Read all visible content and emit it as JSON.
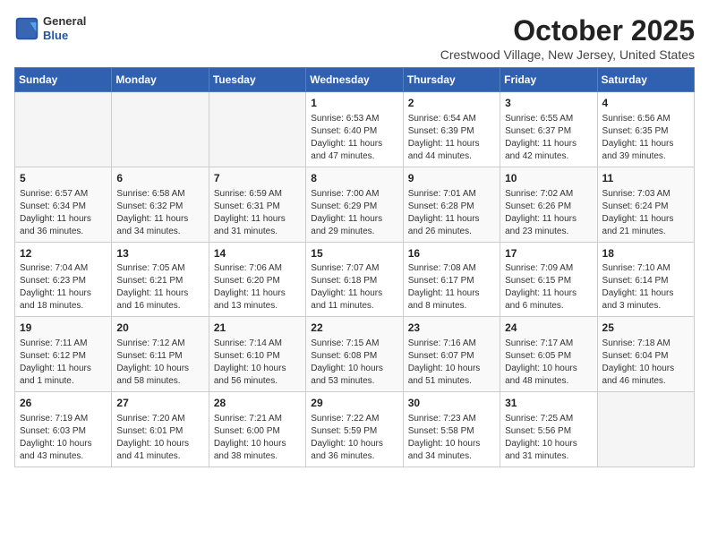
{
  "header": {
    "logo_line1": "General",
    "logo_line2": "Blue",
    "month": "October 2025",
    "location": "Crestwood Village, New Jersey, United States"
  },
  "weekdays": [
    "Sunday",
    "Monday",
    "Tuesday",
    "Wednesday",
    "Thursday",
    "Friday",
    "Saturday"
  ],
  "weeks": [
    [
      {
        "day": "",
        "info": ""
      },
      {
        "day": "",
        "info": ""
      },
      {
        "day": "",
        "info": ""
      },
      {
        "day": "1",
        "info": "Sunrise: 6:53 AM\nSunset: 6:40 PM\nDaylight: 11 hours and 47 minutes."
      },
      {
        "day": "2",
        "info": "Sunrise: 6:54 AM\nSunset: 6:39 PM\nDaylight: 11 hours and 44 minutes."
      },
      {
        "day": "3",
        "info": "Sunrise: 6:55 AM\nSunset: 6:37 PM\nDaylight: 11 hours and 42 minutes."
      },
      {
        "day": "4",
        "info": "Sunrise: 6:56 AM\nSunset: 6:35 PM\nDaylight: 11 hours and 39 minutes."
      }
    ],
    [
      {
        "day": "5",
        "info": "Sunrise: 6:57 AM\nSunset: 6:34 PM\nDaylight: 11 hours and 36 minutes."
      },
      {
        "day": "6",
        "info": "Sunrise: 6:58 AM\nSunset: 6:32 PM\nDaylight: 11 hours and 34 minutes."
      },
      {
        "day": "7",
        "info": "Sunrise: 6:59 AM\nSunset: 6:31 PM\nDaylight: 11 hours and 31 minutes."
      },
      {
        "day": "8",
        "info": "Sunrise: 7:00 AM\nSunset: 6:29 PM\nDaylight: 11 hours and 29 minutes."
      },
      {
        "day": "9",
        "info": "Sunrise: 7:01 AM\nSunset: 6:28 PM\nDaylight: 11 hours and 26 minutes."
      },
      {
        "day": "10",
        "info": "Sunrise: 7:02 AM\nSunset: 6:26 PM\nDaylight: 11 hours and 23 minutes."
      },
      {
        "day": "11",
        "info": "Sunrise: 7:03 AM\nSunset: 6:24 PM\nDaylight: 11 hours and 21 minutes."
      }
    ],
    [
      {
        "day": "12",
        "info": "Sunrise: 7:04 AM\nSunset: 6:23 PM\nDaylight: 11 hours and 18 minutes."
      },
      {
        "day": "13",
        "info": "Sunrise: 7:05 AM\nSunset: 6:21 PM\nDaylight: 11 hours and 16 minutes."
      },
      {
        "day": "14",
        "info": "Sunrise: 7:06 AM\nSunset: 6:20 PM\nDaylight: 11 hours and 13 minutes."
      },
      {
        "day": "15",
        "info": "Sunrise: 7:07 AM\nSunset: 6:18 PM\nDaylight: 11 hours and 11 minutes."
      },
      {
        "day": "16",
        "info": "Sunrise: 7:08 AM\nSunset: 6:17 PM\nDaylight: 11 hours and 8 minutes."
      },
      {
        "day": "17",
        "info": "Sunrise: 7:09 AM\nSunset: 6:15 PM\nDaylight: 11 hours and 6 minutes."
      },
      {
        "day": "18",
        "info": "Sunrise: 7:10 AM\nSunset: 6:14 PM\nDaylight: 11 hours and 3 minutes."
      }
    ],
    [
      {
        "day": "19",
        "info": "Sunrise: 7:11 AM\nSunset: 6:12 PM\nDaylight: 11 hours and 1 minute."
      },
      {
        "day": "20",
        "info": "Sunrise: 7:12 AM\nSunset: 6:11 PM\nDaylight: 10 hours and 58 minutes."
      },
      {
        "day": "21",
        "info": "Sunrise: 7:14 AM\nSunset: 6:10 PM\nDaylight: 10 hours and 56 minutes."
      },
      {
        "day": "22",
        "info": "Sunrise: 7:15 AM\nSunset: 6:08 PM\nDaylight: 10 hours and 53 minutes."
      },
      {
        "day": "23",
        "info": "Sunrise: 7:16 AM\nSunset: 6:07 PM\nDaylight: 10 hours and 51 minutes."
      },
      {
        "day": "24",
        "info": "Sunrise: 7:17 AM\nSunset: 6:05 PM\nDaylight: 10 hours and 48 minutes."
      },
      {
        "day": "25",
        "info": "Sunrise: 7:18 AM\nSunset: 6:04 PM\nDaylight: 10 hours and 46 minutes."
      }
    ],
    [
      {
        "day": "26",
        "info": "Sunrise: 7:19 AM\nSunset: 6:03 PM\nDaylight: 10 hours and 43 minutes."
      },
      {
        "day": "27",
        "info": "Sunrise: 7:20 AM\nSunset: 6:01 PM\nDaylight: 10 hours and 41 minutes."
      },
      {
        "day": "28",
        "info": "Sunrise: 7:21 AM\nSunset: 6:00 PM\nDaylight: 10 hours and 38 minutes."
      },
      {
        "day": "29",
        "info": "Sunrise: 7:22 AM\nSunset: 5:59 PM\nDaylight: 10 hours and 36 minutes."
      },
      {
        "day": "30",
        "info": "Sunrise: 7:23 AM\nSunset: 5:58 PM\nDaylight: 10 hours and 34 minutes."
      },
      {
        "day": "31",
        "info": "Sunrise: 7:25 AM\nSunset: 5:56 PM\nDaylight: 10 hours and 31 minutes."
      },
      {
        "day": "",
        "info": ""
      }
    ]
  ]
}
